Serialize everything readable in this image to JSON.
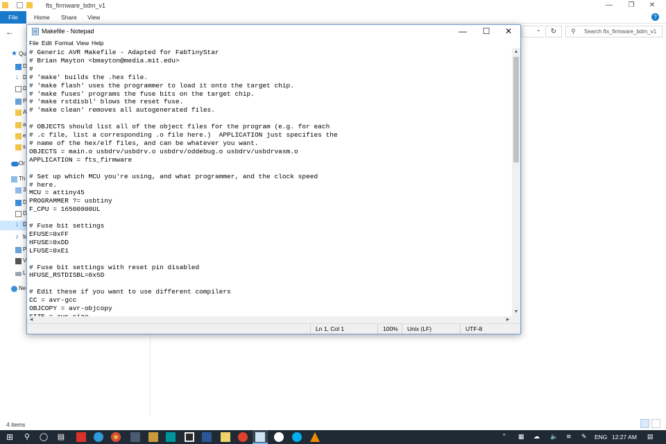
{
  "explorer": {
    "title": "fts_firmware_bdm_v1",
    "ribbon_tabs": [
      "File",
      "Home",
      "Share",
      "View"
    ],
    "search_placeholder": "Search fts_firmware_bdm_v1",
    "nav_items": [
      {
        "label": "Qu",
        "icon": "star-icon"
      },
      {
        "label": "D",
        "icon": "desktop-icon"
      },
      {
        "label": "D",
        "icon": "download-icon"
      },
      {
        "label": "D",
        "icon": "documents-icon"
      },
      {
        "label": "P",
        "icon": "pictures-icon"
      },
      {
        "label": "A",
        "icon": "folder-icon"
      },
      {
        "label": "a",
        "icon": "folder-icon"
      },
      {
        "label": "e",
        "icon": "folder-icon"
      },
      {
        "label": "s",
        "icon": "folder-icon"
      },
      {
        "label": "Or",
        "icon": "onedrive-icon"
      },
      {
        "label": "Th",
        "icon": "this-pc-icon"
      },
      {
        "label": "3",
        "icon": "3d-objects-icon"
      },
      {
        "label": "D",
        "icon": "desktop-icon"
      },
      {
        "label": "D",
        "icon": "documents-icon"
      },
      {
        "label": "D",
        "icon": "download-icon"
      },
      {
        "label": "M",
        "icon": "music-icon"
      },
      {
        "label": "P",
        "icon": "pictures-icon"
      },
      {
        "label": "V",
        "icon": "videos-icon"
      },
      {
        "label": "L",
        "icon": "drive-icon"
      },
      {
        "label": "Ne",
        "icon": "network-icon"
      }
    ],
    "status_count": "4 items"
  },
  "notepad": {
    "title": "Makefile - Notepad",
    "menu": [
      "File",
      "Edit",
      "Format",
      "View",
      "Help"
    ],
    "content": "# Generic AVR Makefile - Adapted for FabTinyStar\n# Brian Mayton <bmayton@media.mit.edu>\n#\n# 'make' builds the .hex file.\n# 'make flash' uses the programmer to load it onto the target chip.\n# 'make fuses' programs the fuse bits on the target chip.\n# 'make rstdisbl' blows the reset fuse.\n# 'make clean' removes all autogenerated files.\n\n# OBJECTS should list all of the object files for the program (e.g. for each\n# .c file, list a corresponding .o file here.)  APPLICATION just specifies the\n# name of the hex/elf files, and can be whatever you want.\nOBJECTS = main.o usbdrv/usbdrv.o usbdrv/oddebug.o usbdrv/usbdrvasm.o\nAPPLICATION = fts_firmware\n\n# Set up which MCU you're using, and what programmer, and the clock speed\n# here.\nMCU = attiny45\nPROGRAMMER ?= usbtiny\nF_CPU = 16500000UL\n\n# Fuse bit settings\nEFUSE=0xFF\nHFUSE=0xDD\nLFUSE=0xE1\n\n# Fuse bit settings with reset pin disabled\nHFUSE_RSTDISBL=0x5D\n\n# Edit these if you want to use different compilers\nCC = avr-gcc\nOBJCOPY = avr-objcopy\nSIZE = avr-size",
    "status": {
      "position": "Ln 1, Col 1",
      "zoom": "100%",
      "line_ending": "Unix (LF)",
      "encoding": "UTF-8"
    }
  },
  "taskbar": {
    "apps": [
      "search-icon",
      "cortana-icon",
      "task-view-icon",
      "acrobat-icon",
      "edge-icon",
      "chrome-icon",
      "app-icon",
      "arduino-icon",
      "inkscape-icon",
      "word-icon",
      "paint-icon",
      "app-icon",
      "notepad-icon",
      "app-icon",
      "skype-icon",
      "vlc-icon"
    ],
    "language": "ENG",
    "time": "12:27 AM"
  },
  "colors": {
    "explorer_file_tab": "#1979ca",
    "taskbar": "#1f2a35",
    "notepad_border": "#6f9ccc"
  }
}
